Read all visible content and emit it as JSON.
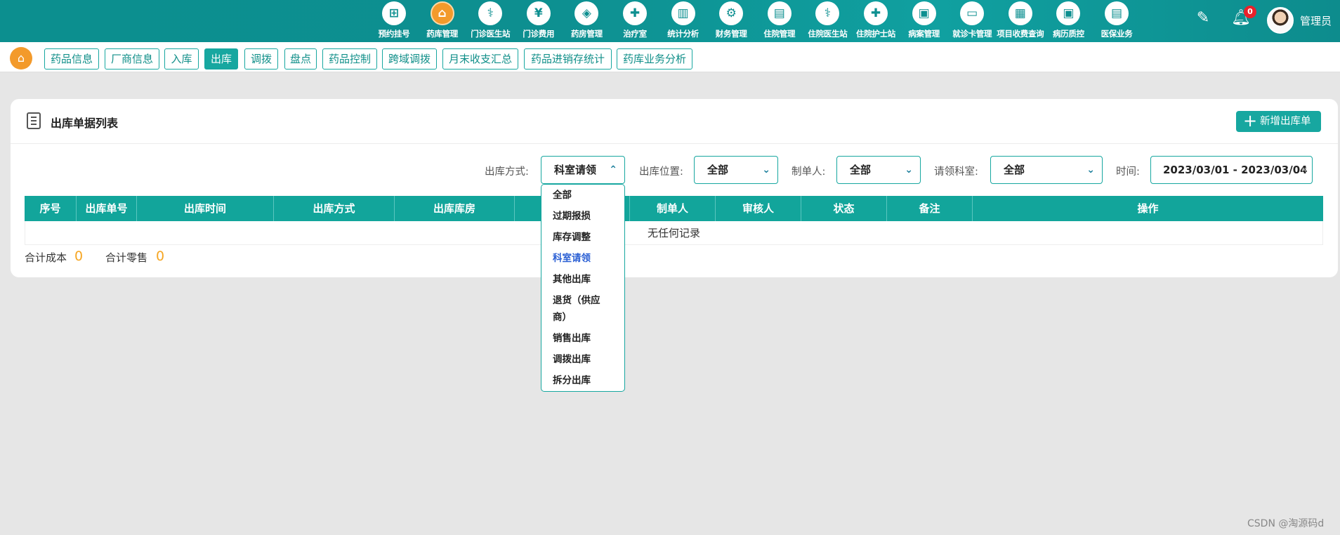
{
  "topnav": {
    "items": [
      {
        "label": "预约挂号",
        "icon": "calendar-plus-icon",
        "glyph": "⊞",
        "active": false
      },
      {
        "label": "药库管理",
        "icon": "home-pharmacy-icon",
        "glyph": "⌂",
        "active": true
      },
      {
        "label": "门诊医生站",
        "icon": "doctor-icon",
        "glyph": "⚕",
        "active": false
      },
      {
        "label": "门诊费用",
        "icon": "yen-icon",
        "glyph": "¥",
        "active": false
      },
      {
        "label": "药房管理",
        "icon": "pill-icon",
        "glyph": "◈",
        "active": false
      },
      {
        "label": "治疗室",
        "icon": "nurse-icon",
        "glyph": "✚",
        "active": false
      },
      {
        "label": "统计分析",
        "icon": "chart-icon",
        "glyph": "▥",
        "active": false
      },
      {
        "label": "财务管理",
        "icon": "gear-money-icon",
        "glyph": "⚙",
        "active": false
      },
      {
        "label": "住院管理",
        "icon": "bed-icon",
        "glyph": "▤",
        "active": false
      },
      {
        "label": "住院医生站",
        "icon": "doctor-card-icon",
        "glyph": "⚕",
        "active": false
      },
      {
        "label": "住院护士站",
        "icon": "nurse-cap-icon",
        "glyph": "✚",
        "active": false
      },
      {
        "label": "病案管理",
        "icon": "folder-icon",
        "glyph": "▣",
        "active": false
      },
      {
        "label": "就诊卡管理",
        "icon": "card-icon",
        "glyph": "▭",
        "active": false
      },
      {
        "label": "项目收费查询",
        "icon": "search-fee-icon",
        "glyph": "▦",
        "active": false
      },
      {
        "label": "病历质控",
        "icon": "record-icon",
        "glyph": "▣",
        "active": false
      },
      {
        "label": "医保业务",
        "icon": "insurance-icon",
        "glyph": "▤",
        "active": false
      }
    ],
    "bell_count": "0",
    "user_name": "管理员"
  },
  "subtabs": [
    {
      "label": "药品信息",
      "active": false
    },
    {
      "label": "厂商信息",
      "active": false
    },
    {
      "label": "入库",
      "active": false
    },
    {
      "label": "出库",
      "active": true
    },
    {
      "label": "调拨",
      "active": false
    },
    {
      "label": "盘点",
      "active": false
    },
    {
      "label": "药品控制",
      "active": false
    },
    {
      "label": "跨域调拨",
      "active": false
    },
    {
      "label": "月末收支汇总",
      "active": false
    },
    {
      "label": "药品进销存统计",
      "active": false
    },
    {
      "label": "药库业务分析",
      "active": false
    }
  ],
  "panel": {
    "title": "出库单据列表",
    "add_button": "新增出库单"
  },
  "filters": {
    "method_label": "出库方式:",
    "method_value": "科室请领",
    "location_label": "出库位置:",
    "location_value": "全部",
    "maker_label": "制单人:",
    "maker_value": "全部",
    "dept_label": "请领科室:",
    "dept_value": "全部",
    "time_label": "时间:",
    "time_value": "2023/03/01 - 2023/03/04"
  },
  "table": {
    "columns": [
      "序号",
      "出库单号",
      "出库时间",
      "出库方式",
      "出库库房",
      "",
      "制单人",
      "审核人",
      "状态",
      "备注",
      "操作"
    ],
    "empty_text": "无任何记录"
  },
  "totals": {
    "cost_label": "合计成本",
    "cost_value": "0",
    "retail_label": "合计零售",
    "retail_value": "0"
  },
  "dropdown": {
    "options": [
      "全部",
      "过期报损",
      "库存调整",
      "科室请领",
      "其他出库",
      "退货（供应商）",
      "销售出库",
      "调拨出库",
      "拆分出库"
    ],
    "selected": "科室请领"
  },
  "watermark": "CSDN @淘源码d",
  "colors": {
    "primary": "#17a7a0",
    "topbar": "#0d8f90",
    "accent": "#f39a2b",
    "total": "#f6a623",
    "selected_option": "#2a5fd4"
  }
}
